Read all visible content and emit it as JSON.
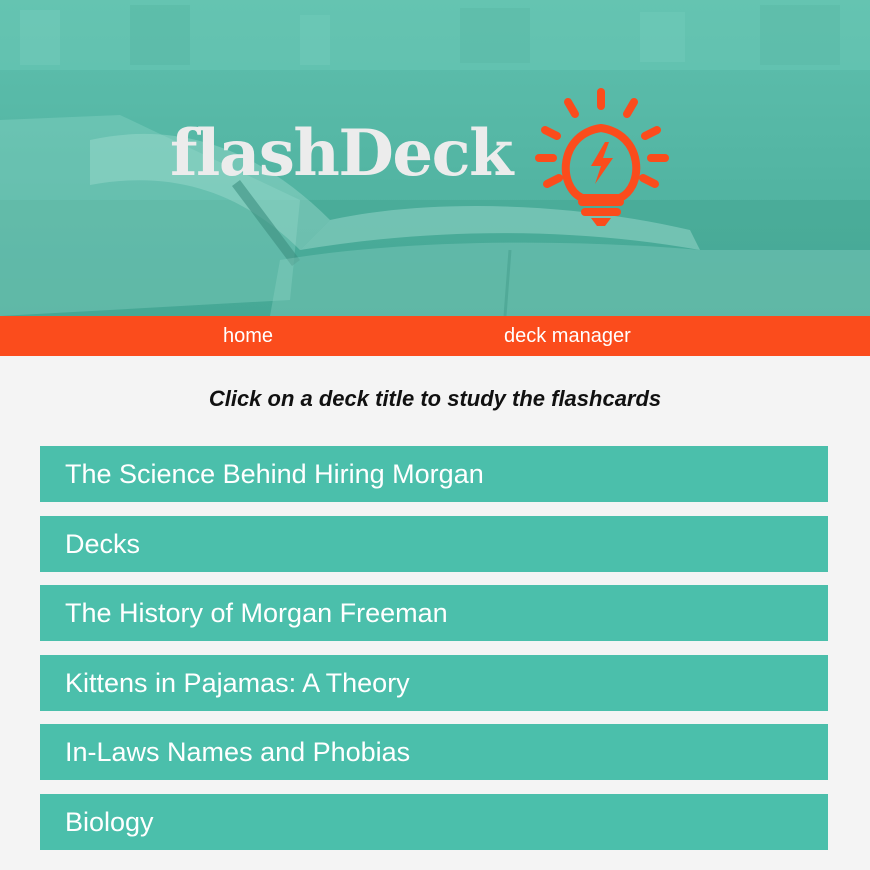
{
  "brand": {
    "name": "flashDeck",
    "accent_color": "#fb4c1c",
    "teal_color": "#4bbfab",
    "logo_icon": "lightbulb-lightning-icon"
  },
  "nav": {
    "items": [
      {
        "label": "home"
      },
      {
        "label": "deck manager"
      }
    ]
  },
  "main": {
    "instructions": "Click on a deck title to study the flashcards",
    "decks": [
      {
        "title": "The Science Behind Hiring Morgan"
      },
      {
        "title": "Decks"
      },
      {
        "title": "The History of Morgan Freeman"
      },
      {
        "title": "Kittens in Pajamas: A Theory"
      },
      {
        "title": "In-Laws Names and Phobias"
      },
      {
        "title": "Biology"
      }
    ]
  }
}
